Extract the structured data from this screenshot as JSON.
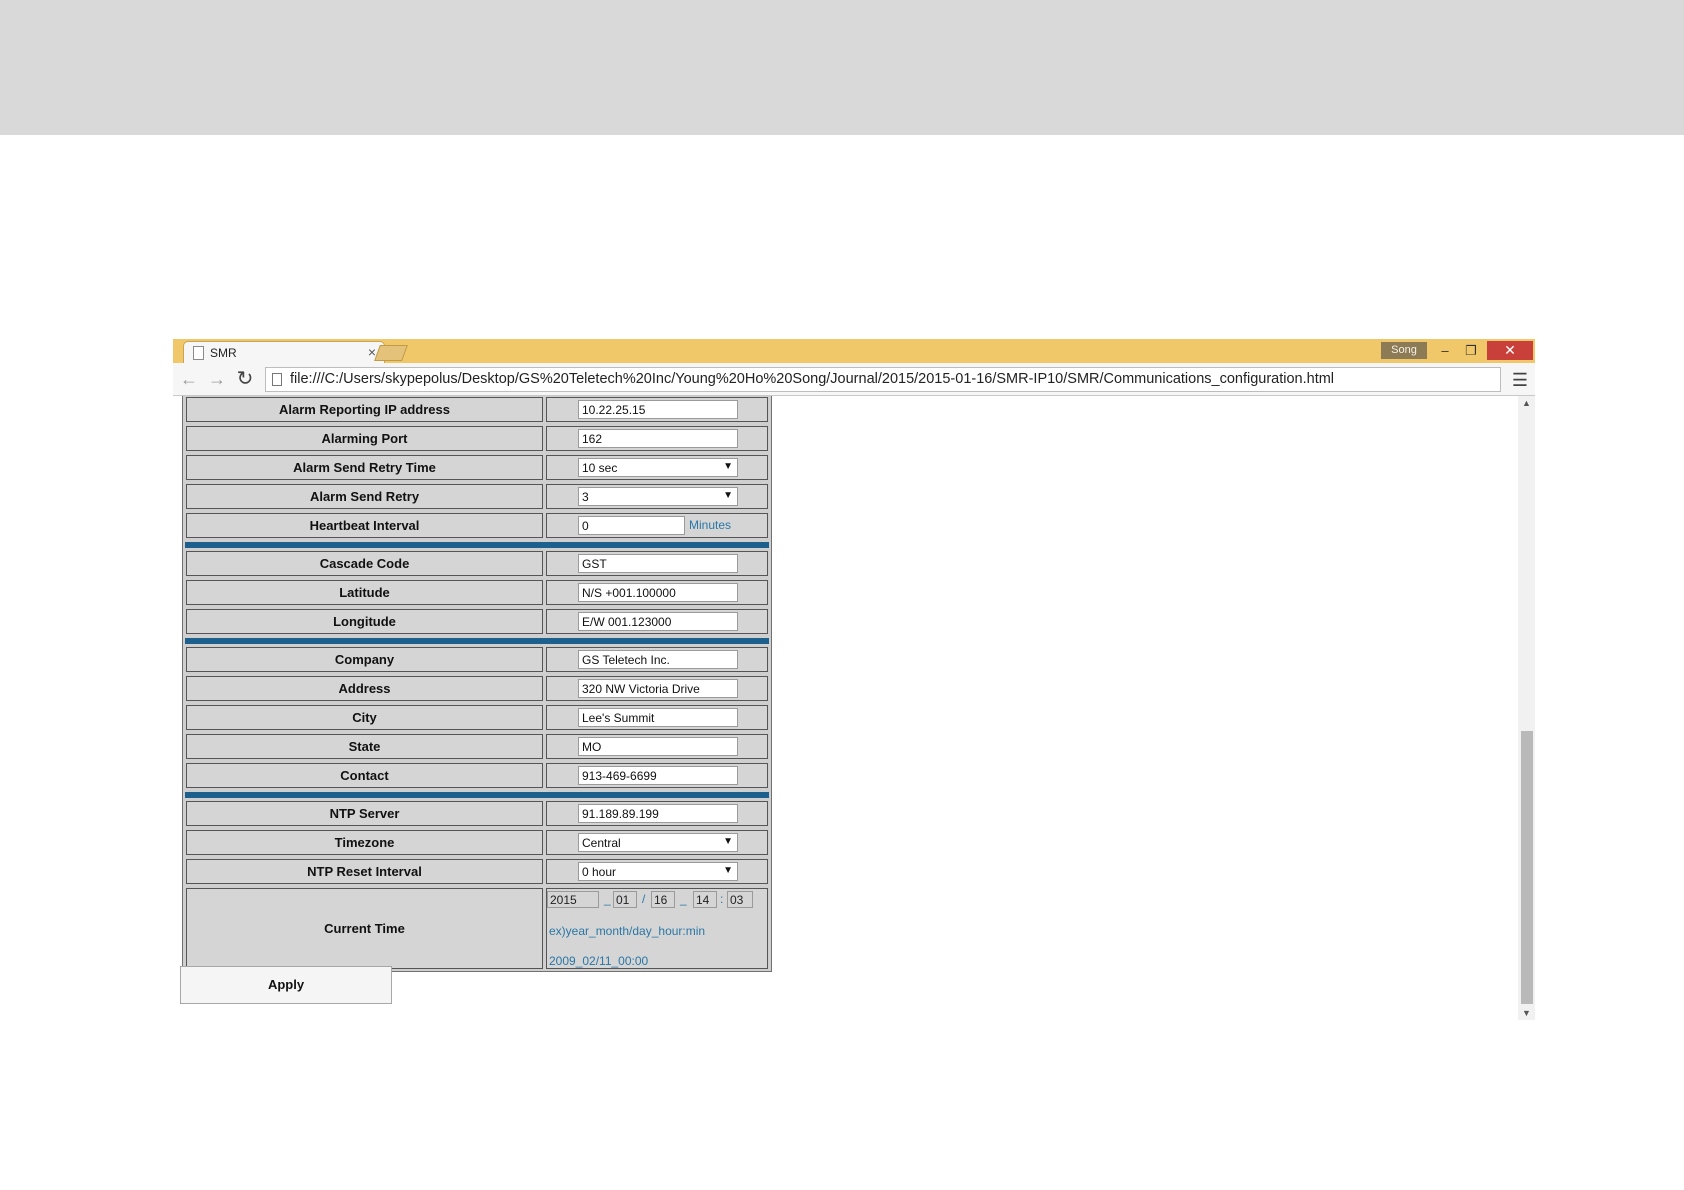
{
  "browser": {
    "tab_title": "SMR",
    "tab_close": "×",
    "user_badge": "Song",
    "win_min": "–",
    "win_max": "❐",
    "win_close": "✕",
    "url": "file:///C:/Users/skypepolus/Desktop/GS%20Teletech%20Inc/Young%20Ho%20Song/Journal/2015/2015-01-16/SMR-IP10/SMR/Communications_configuration.html",
    "icons": {
      "back": "back-arrow-icon",
      "forward": "forward-arrow-icon",
      "reload": "reload-icon",
      "star": "star-icon",
      "menu": "hamburger-menu-icon"
    }
  },
  "form": {
    "alarm_ip": {
      "label": "Alarm Reporting IP address",
      "value": "10.22.25.15"
    },
    "alarm_port": {
      "label": "Alarming Port",
      "value": "162"
    },
    "retry_time": {
      "label": "Alarm Send Retry Time",
      "value": "10 sec"
    },
    "retry": {
      "label": "Alarm Send Retry",
      "value": "3"
    },
    "heartbeat": {
      "label": "Heartbeat Interval",
      "value": "0",
      "unit": "Minutes"
    },
    "cascade": {
      "label": "Cascade Code",
      "value": "GST"
    },
    "latitude": {
      "label": "Latitude",
      "value": "N/S +001.100000"
    },
    "longitude": {
      "label": "Longitude",
      "value": "E/W 001.123000"
    },
    "company": {
      "label": "Company",
      "value": "GS Teletech Inc."
    },
    "address": {
      "label": "Address",
      "value": "320 NW Victoria Drive"
    },
    "city": {
      "label": "City",
      "value": "Lee's Summit"
    },
    "state": {
      "label": "State",
      "value": "MO"
    },
    "contact": {
      "label": "Contact",
      "value": "913-469-6699"
    },
    "ntp_server": {
      "label": "NTP Server",
      "value": "91.189.89.199"
    },
    "timezone": {
      "label": "Timezone",
      "value": "Central"
    },
    "ntp_reset": {
      "label": "NTP Reset Interval",
      "value": "0 hour"
    },
    "current_time": {
      "label": "Current Time",
      "year": "2015",
      "month": "01",
      "day": "16",
      "hour": "14",
      "minute": "03",
      "sep_year_month": "_",
      "sep_month_day": "/",
      "sep_day_hour": "_",
      "sep_hour_min": ":",
      "hint_format": "ex)year_month/day_hour:min",
      "hint_example": "2009_02/11_00:00"
    },
    "apply_label": "Apply"
  },
  "colors": {
    "tab_bar": "#f0c869",
    "section_separator": "#1d5f8d",
    "hint_text": "#2a77a6",
    "close_button": "#c9403a"
  }
}
